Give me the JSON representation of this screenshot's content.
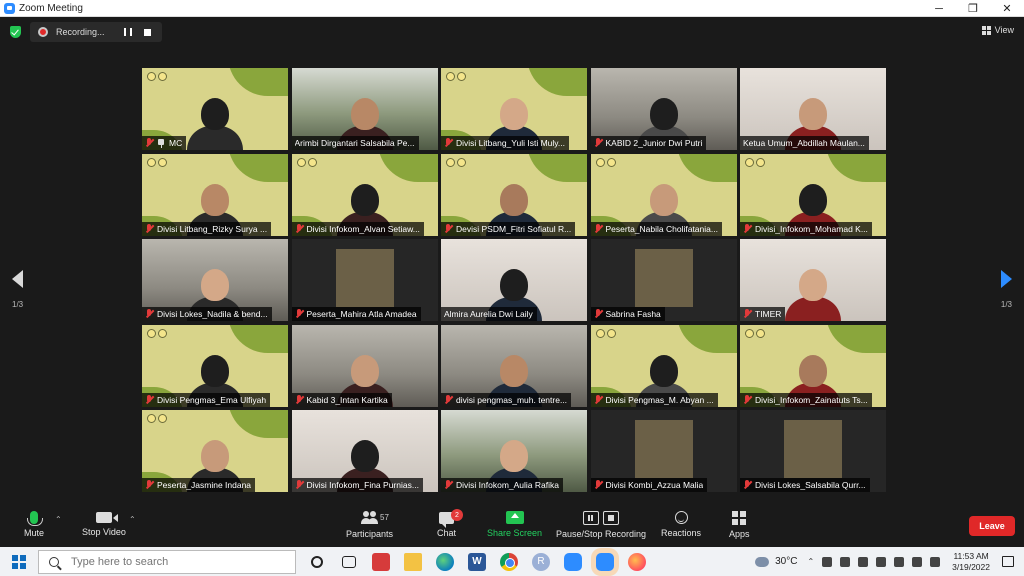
{
  "window": {
    "title": "Zoom Meeting"
  },
  "recording": {
    "label": "Recording..."
  },
  "view": {
    "label": "View"
  },
  "pagination": {
    "left_page": "1/3",
    "right_page": "1/3"
  },
  "participants_tiles": [
    {
      "name": "MC",
      "bg": "yellow",
      "active": true,
      "pinned": true
    },
    {
      "name": "Arimbi Dirgantari Salsabila Pe...",
      "bg": "outdoor",
      "active": false,
      "muted": false
    },
    {
      "name": "Divisi Litbang_Yuli Isti Muly...",
      "bg": "yellow",
      "muted": true
    },
    {
      "name": "KABID 2_Junior Dwi Putri",
      "bg": "room",
      "muted": true
    },
    {
      "name": "Ketua Umum_Abdillah Maulan...",
      "bg": "light",
      "muted": false
    },
    {
      "name": "Divisi Litbang_Rizky Surya ...",
      "bg": "yellow",
      "muted": true
    },
    {
      "name": "Divisi Infokom_Alvan Setiaw...",
      "bg": "yellow",
      "muted": true
    },
    {
      "name": "Devisi PSDM_Fitri Sofiatul R...",
      "bg": "yellow",
      "muted": true
    },
    {
      "name": "Peserta_Nabila Cholifatania...",
      "bg": "yellow",
      "muted": true
    },
    {
      "name": "Divisi_Infokom_Mohamad K...",
      "bg": "yellow",
      "muted": true
    },
    {
      "name": "Divisi Lokes_Nadila & bend...",
      "bg": "room",
      "muted": true
    },
    {
      "name": "Peserta_Mahira Atla Amadea",
      "bg": "dark",
      "muted": true,
      "inset": true
    },
    {
      "name": "Almira Aurelia Dwi Laily",
      "bg": "light",
      "muted": false
    },
    {
      "name": "Sabrina Fasha",
      "bg": "dark",
      "muted": true,
      "inset": true
    },
    {
      "name": "TIMER",
      "bg": "light",
      "muted": true
    },
    {
      "name": "Divisi Pengmas_Ema Ulfiyah",
      "bg": "yellow",
      "muted": true
    },
    {
      "name": "Kabid 3_Intan Kartika",
      "bg": "room",
      "muted": true
    },
    {
      "name": "divisi pengmas_muh. tentre...",
      "bg": "room",
      "muted": true
    },
    {
      "name": "Divisi Pengmas_M. Abyan ...",
      "bg": "yellow",
      "muted": true
    },
    {
      "name": "Divisi_Infokom_Zainatuts Ts...",
      "bg": "yellow",
      "muted": true
    },
    {
      "name": "Peserta_Jasmine Indana",
      "bg": "yellow",
      "muted": true
    },
    {
      "name": "Divisi Infokom_Fina Purnias...",
      "bg": "light",
      "muted": true
    },
    {
      "name": "Divisi Infokom_Aulia Rafika",
      "bg": "outdoor",
      "muted": true
    },
    {
      "name": "Divisi Kombi_Azzua Malia",
      "bg": "dark",
      "muted": true,
      "inset": true
    },
    {
      "name": "Divisi Lokes_Salsabila Qurr...",
      "bg": "dark",
      "muted": true,
      "inset": true
    }
  ],
  "toolbar": {
    "mute": "Mute",
    "stop_video": "Stop Video",
    "participants": "Participants",
    "participants_count": "57",
    "chat": "Chat",
    "chat_badge": "2",
    "share_screen": "Share Screen",
    "pause_stop_recording": "Pause/Stop Recording",
    "reactions": "Reactions",
    "apps": "Apps",
    "leave": "Leave"
  },
  "taskbar": {
    "search_placeholder": "Type here to search",
    "word_letter": "W",
    "avatar_letter": "R",
    "temperature": "30°C",
    "time": "11:53 AM",
    "date": "3/19/2022"
  },
  "colors": {
    "accent": "#2d8cff",
    "leave": "#e02828",
    "share": "#23c552",
    "active_speaker": "#c9e64c"
  }
}
